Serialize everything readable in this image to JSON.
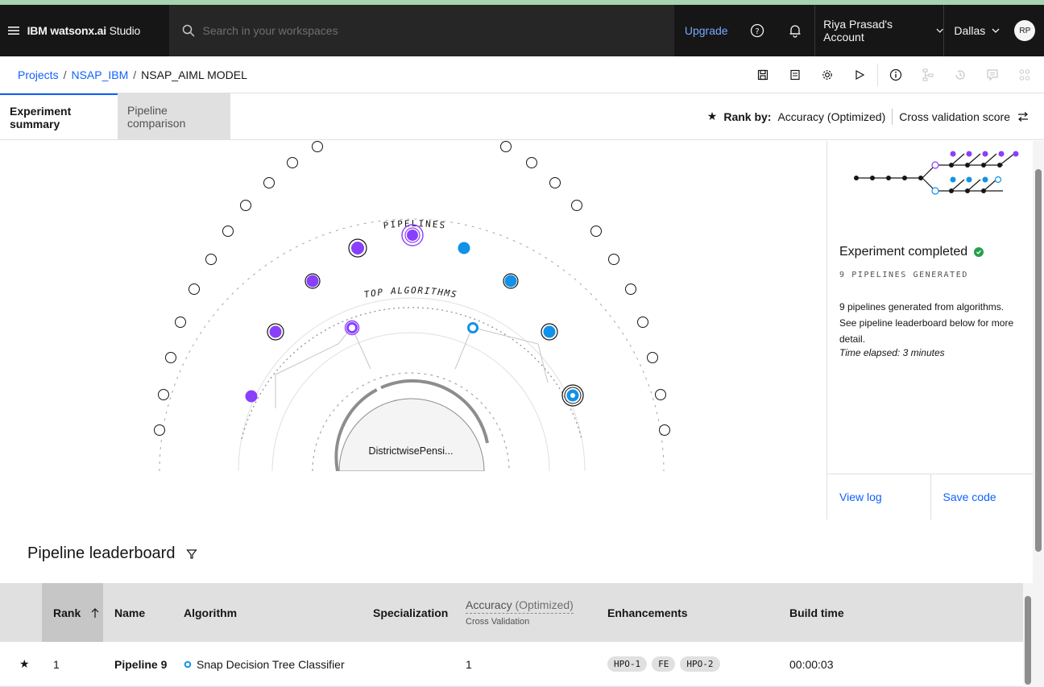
{
  "header": {
    "brand_bold": "IBM watsonx.ai",
    "brand_rest": " Studio",
    "search_placeholder": "Search in your workspaces",
    "upgrade": "Upgrade",
    "account": "Riya Prasad's Account",
    "region": "Dallas",
    "avatar_initials": "RP"
  },
  "breadcrumb": {
    "items": [
      "Projects",
      "NSAP_IBM",
      "NSAP_AIML MODEL"
    ],
    "separator": "/"
  },
  "tabs": {
    "active": "Experiment summary",
    "inactive": "Pipeline comparison"
  },
  "rank": {
    "label": "Rank by:",
    "metric": "Accuracy (Optimized)",
    "score": "Cross validation score"
  },
  "visualization": {
    "pipelines_label": "PIPELINES",
    "algorithms_label": "TOP ALGORITHMS",
    "dataset_label": "DistrictwisePensi...",
    "colors": {
      "purple": "#8a3ffc",
      "blue": "#1192e8",
      "line": "#8d8d8d"
    }
  },
  "panel": {
    "status": "Experiment completed",
    "count": "9 PIPELINES GENERATED",
    "description": "9 pipelines generated from algorithms. See pipeline leaderboard below for more detail.",
    "time": "Time elapsed: 3 minutes",
    "view_log": "View log",
    "save_code": "Save code"
  },
  "leaderboard": {
    "title": "Pipeline leaderboard",
    "columns": {
      "rank": "Rank",
      "name": "Name",
      "algorithm": "Algorithm",
      "specialization": "Specialization",
      "accuracy_main": "Accuracy",
      "accuracy_opt": "(Optimized)",
      "accuracy_sub": "Cross Validation",
      "enhancements": "Enhancements",
      "build_time": "Build time"
    },
    "rows": [
      {
        "rank": "1",
        "name": "Pipeline 9",
        "algorithm": "Snap Decision Tree Classifier",
        "specialization": "",
        "accuracy": "1",
        "enhancements": [
          "HPO-1",
          "FE",
          "HPO-2"
        ],
        "build_time": "00:00:03"
      }
    ]
  }
}
